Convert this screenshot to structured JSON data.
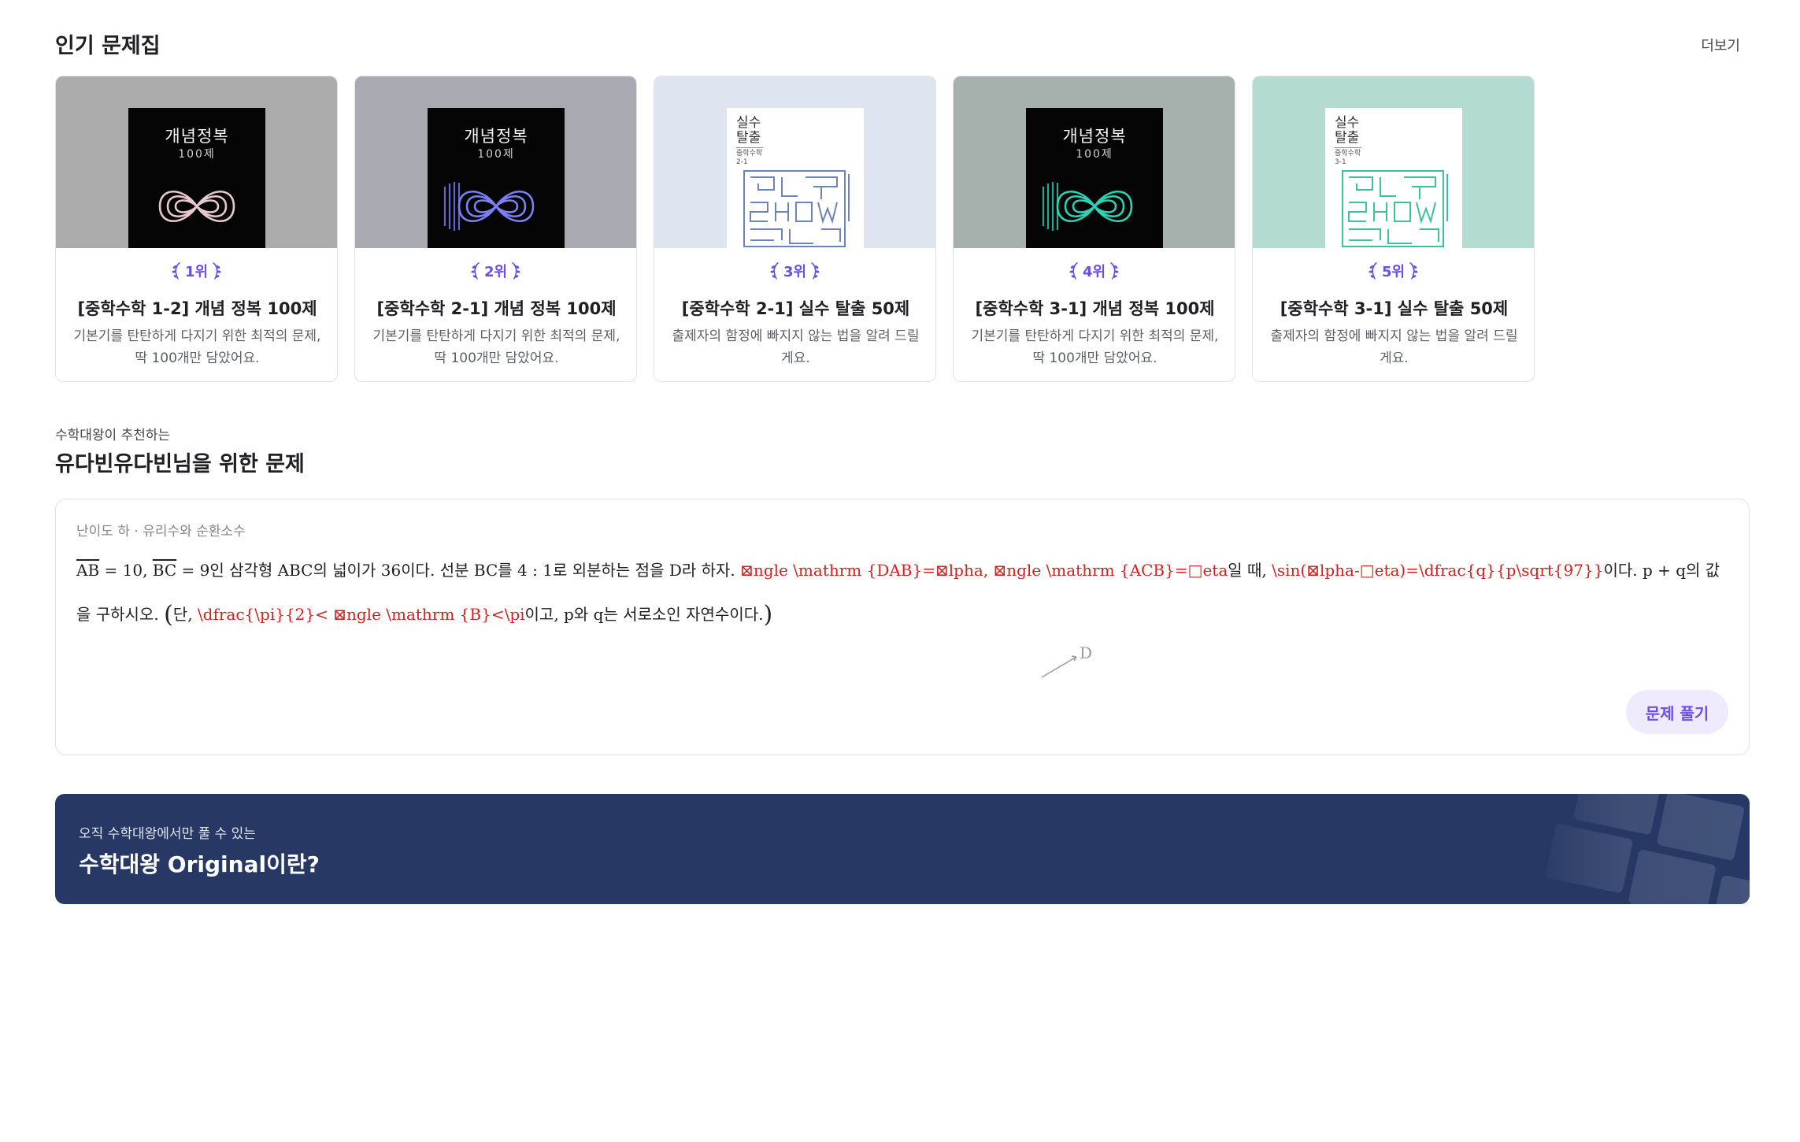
{
  "popular": {
    "title": "인기 문제집",
    "more_label": "더보기",
    "books": [
      {
        "rank": "1위",
        "title": "[중학수학 1-2] 개념 정복 100제",
        "desc": "기본기를 탄탄하게 다지기 위한 최적의 문제, 딱 100개만 담았어요.",
        "cover_title": "개념정복",
        "cover_sub": "100제",
        "cover_bg": "#acacac",
        "accent": "#e8c8cf"
      },
      {
        "rank": "2위",
        "title": "[중학수학 2-1] 개념 정복 100제",
        "desc": "기본기를 탄탄하게 다지기 위한 최적의 문제, 딱 100개만 담았어요.",
        "cover_title": "개념정복",
        "cover_sub": "100제",
        "cover_bg": "#a9aab1",
        "accent": "#7c7ff5"
      },
      {
        "rank": "3위",
        "title": "[중학수학 2-1] 실수 탈출 50제",
        "desc": "출제자의 함정에 빠지지 않는 법을 알려 드릴게요.",
        "cover_title": "실수 탈출",
        "cover_sub": "중학수학 2-1",
        "cover_bg": "#dfe5f0",
        "accent": "#6c84b8"
      },
      {
        "rank": "4위",
        "title": "[중학수학 3-1] 개념 정복 100제",
        "desc": "기본기를 탄탄하게 다지기 위한 최적의 문제, 딱 100개만 담았어요.",
        "cover_title": "개념정복",
        "cover_sub": "100제",
        "cover_bg": "#a6b0ad",
        "accent": "#2bd3b5"
      },
      {
        "rank": "5위",
        "title": "[중학수학 3-1] 실수 탈출 50제",
        "desc": "출제자의 함정에 빠지지 않는 법을 알려 드릴게요.",
        "cover_title": "실수 탈출",
        "cover_sub": "중학수학 3-1",
        "cover_bg": "#b3dbd1",
        "accent": "#3cc39e"
      }
    ]
  },
  "recommend": {
    "subtitle": "수학대왕이 추천하는",
    "title": "유다빈유다빈님을 위한 문제",
    "problem": {
      "meta": "난이도 하 · 유리수와 순환소수",
      "t1": "AB",
      "t2": " = 10,  ",
      "t3": "BC",
      "t4": " = 9인 삼각형 ABC의 넓이가 36이다. 선분 BC를 4 : 1로 외분하는 점을 D라 하자. ",
      "e1": "⊠ngle \\mathrm {DAB}=⊠lpha, ⊠ngle \\mathrm {ACB}=□eta",
      "t5": "일 때, ",
      "e2": "\\sin(⊠lpha-□eta)=\\dfrac{q}{p\\sqrt{97}}",
      "t6": "이다. p + q의 값을 구하시오. ",
      "lparen": "(",
      "t7": "단, ",
      "e3": "\\dfrac{\\pi}{2}< ⊠ngle \\mathrm {B}<\\pi",
      "t8": "이고, p와 q는 서로소인 자연수이다.",
      "rparen": ")",
      "figure_label": "D",
      "solve_label": "문제 풀기"
    }
  },
  "banner": {
    "subtitle": "오직 수학대왕에서만 풀 수 있는",
    "title": "수학대왕 Original이란?",
    "bg": "#273864"
  },
  "colors": {
    "rank_purple": "#6b4ee6",
    "latex_error_red": "#d4211f"
  }
}
